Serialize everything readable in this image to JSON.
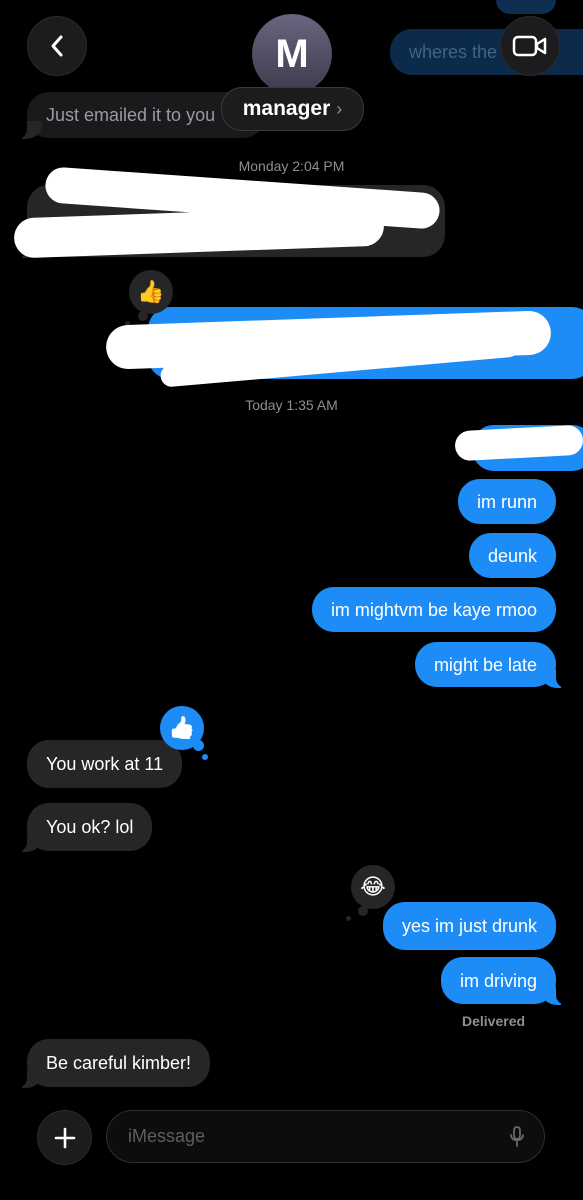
{
  "header": {
    "contact_initial": "M",
    "contact_name": "manager",
    "chevron": "›",
    "back_icon": "chevron-left-icon",
    "video_icon": "video-camera-icon"
  },
  "ghost_messages": {
    "top_outgoing": "wheres the",
    "top_incoming": "Just emailed it to you"
  },
  "timestamps": {
    "first": "Monday 2:04 PM",
    "second": "Today 1:35 AM"
  },
  "messages": [
    {
      "dir": "out",
      "text": "im runn"
    },
    {
      "dir": "out",
      "text": "deunk"
    },
    {
      "dir": "out",
      "text": "im mightvm be kaye rmoo"
    },
    {
      "dir": "out",
      "text": "might be late"
    },
    {
      "dir": "in",
      "text": "You work at 11"
    },
    {
      "dir": "in",
      "text": "You ok? lol"
    },
    {
      "dir": "out",
      "text": "yes im just drunk"
    },
    {
      "dir": "out",
      "text": "im driving"
    },
    {
      "dir": "in",
      "text": "Be careful kimber!"
    }
  ],
  "reactions": {
    "thumbs_emoji": "👍",
    "laugh_emoji": "😂",
    "like_tapback": "👍"
  },
  "status": {
    "delivered": "Delivered"
  },
  "composer": {
    "placeholder": "iMessage",
    "add_icon": "plus-icon",
    "mic_icon": "microphone-icon"
  },
  "colors": {
    "outgoing": "#1e8cf7",
    "incoming": "#262628",
    "background": "#000000"
  }
}
